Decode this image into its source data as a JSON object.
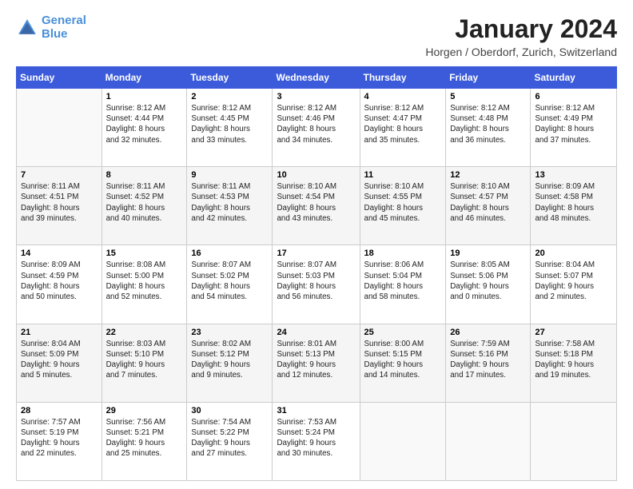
{
  "header": {
    "logo_line1": "General",
    "logo_line2": "Blue",
    "main_title": "January 2024",
    "subtitle": "Horgen / Oberdorf, Zurich, Switzerland"
  },
  "weekdays": [
    "Sunday",
    "Monday",
    "Tuesday",
    "Wednesday",
    "Thursday",
    "Friday",
    "Saturday"
  ],
  "weeks": [
    [
      {
        "num": "",
        "info": ""
      },
      {
        "num": "1",
        "info": "Sunrise: 8:12 AM\nSunset: 4:44 PM\nDaylight: 8 hours\nand 32 minutes."
      },
      {
        "num": "2",
        "info": "Sunrise: 8:12 AM\nSunset: 4:45 PM\nDaylight: 8 hours\nand 33 minutes."
      },
      {
        "num": "3",
        "info": "Sunrise: 8:12 AM\nSunset: 4:46 PM\nDaylight: 8 hours\nand 34 minutes."
      },
      {
        "num": "4",
        "info": "Sunrise: 8:12 AM\nSunset: 4:47 PM\nDaylight: 8 hours\nand 35 minutes."
      },
      {
        "num": "5",
        "info": "Sunrise: 8:12 AM\nSunset: 4:48 PM\nDaylight: 8 hours\nand 36 minutes."
      },
      {
        "num": "6",
        "info": "Sunrise: 8:12 AM\nSunset: 4:49 PM\nDaylight: 8 hours\nand 37 minutes."
      }
    ],
    [
      {
        "num": "7",
        "info": "Sunrise: 8:11 AM\nSunset: 4:51 PM\nDaylight: 8 hours\nand 39 minutes."
      },
      {
        "num": "8",
        "info": "Sunrise: 8:11 AM\nSunset: 4:52 PM\nDaylight: 8 hours\nand 40 minutes."
      },
      {
        "num": "9",
        "info": "Sunrise: 8:11 AM\nSunset: 4:53 PM\nDaylight: 8 hours\nand 42 minutes."
      },
      {
        "num": "10",
        "info": "Sunrise: 8:10 AM\nSunset: 4:54 PM\nDaylight: 8 hours\nand 43 minutes."
      },
      {
        "num": "11",
        "info": "Sunrise: 8:10 AM\nSunset: 4:55 PM\nDaylight: 8 hours\nand 45 minutes."
      },
      {
        "num": "12",
        "info": "Sunrise: 8:10 AM\nSunset: 4:57 PM\nDaylight: 8 hours\nand 46 minutes."
      },
      {
        "num": "13",
        "info": "Sunrise: 8:09 AM\nSunset: 4:58 PM\nDaylight: 8 hours\nand 48 minutes."
      }
    ],
    [
      {
        "num": "14",
        "info": "Sunrise: 8:09 AM\nSunset: 4:59 PM\nDaylight: 8 hours\nand 50 minutes."
      },
      {
        "num": "15",
        "info": "Sunrise: 8:08 AM\nSunset: 5:00 PM\nDaylight: 8 hours\nand 52 minutes."
      },
      {
        "num": "16",
        "info": "Sunrise: 8:07 AM\nSunset: 5:02 PM\nDaylight: 8 hours\nand 54 minutes."
      },
      {
        "num": "17",
        "info": "Sunrise: 8:07 AM\nSunset: 5:03 PM\nDaylight: 8 hours\nand 56 minutes."
      },
      {
        "num": "18",
        "info": "Sunrise: 8:06 AM\nSunset: 5:04 PM\nDaylight: 8 hours\nand 58 minutes."
      },
      {
        "num": "19",
        "info": "Sunrise: 8:05 AM\nSunset: 5:06 PM\nDaylight: 9 hours\nand 0 minutes."
      },
      {
        "num": "20",
        "info": "Sunrise: 8:04 AM\nSunset: 5:07 PM\nDaylight: 9 hours\nand 2 minutes."
      }
    ],
    [
      {
        "num": "21",
        "info": "Sunrise: 8:04 AM\nSunset: 5:09 PM\nDaylight: 9 hours\nand 5 minutes."
      },
      {
        "num": "22",
        "info": "Sunrise: 8:03 AM\nSunset: 5:10 PM\nDaylight: 9 hours\nand 7 minutes."
      },
      {
        "num": "23",
        "info": "Sunrise: 8:02 AM\nSunset: 5:12 PM\nDaylight: 9 hours\nand 9 minutes."
      },
      {
        "num": "24",
        "info": "Sunrise: 8:01 AM\nSunset: 5:13 PM\nDaylight: 9 hours\nand 12 minutes."
      },
      {
        "num": "25",
        "info": "Sunrise: 8:00 AM\nSunset: 5:15 PM\nDaylight: 9 hours\nand 14 minutes."
      },
      {
        "num": "26",
        "info": "Sunrise: 7:59 AM\nSunset: 5:16 PM\nDaylight: 9 hours\nand 17 minutes."
      },
      {
        "num": "27",
        "info": "Sunrise: 7:58 AM\nSunset: 5:18 PM\nDaylight: 9 hours\nand 19 minutes."
      }
    ],
    [
      {
        "num": "28",
        "info": "Sunrise: 7:57 AM\nSunset: 5:19 PM\nDaylight: 9 hours\nand 22 minutes."
      },
      {
        "num": "29",
        "info": "Sunrise: 7:56 AM\nSunset: 5:21 PM\nDaylight: 9 hours\nand 25 minutes."
      },
      {
        "num": "30",
        "info": "Sunrise: 7:54 AM\nSunset: 5:22 PM\nDaylight: 9 hours\nand 27 minutes."
      },
      {
        "num": "31",
        "info": "Sunrise: 7:53 AM\nSunset: 5:24 PM\nDaylight: 9 hours\nand 30 minutes."
      },
      {
        "num": "",
        "info": ""
      },
      {
        "num": "",
        "info": ""
      },
      {
        "num": "",
        "info": ""
      }
    ]
  ]
}
